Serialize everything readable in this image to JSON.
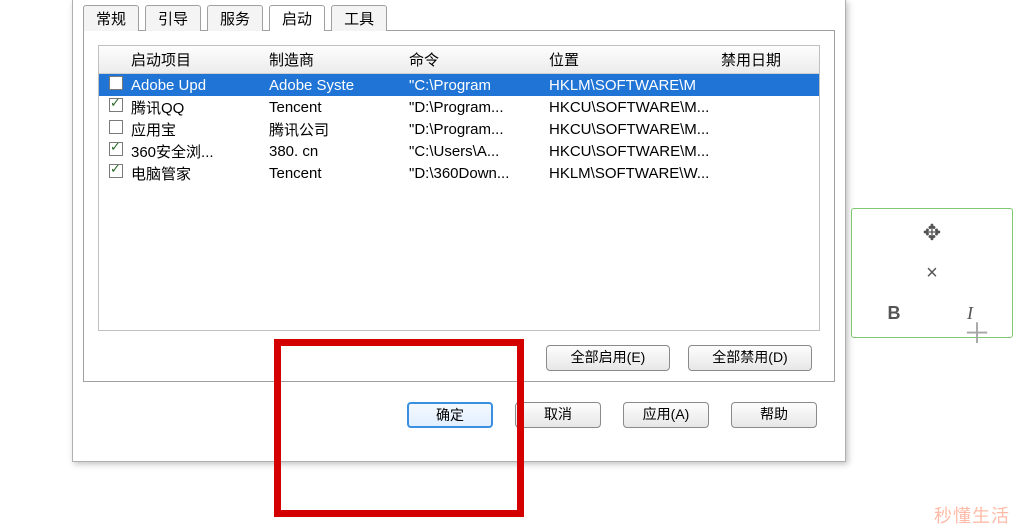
{
  "tabs": {
    "items": [
      {
        "label": "常规",
        "active": false
      },
      {
        "label": "引导",
        "active": false
      },
      {
        "label": "服务",
        "active": false
      },
      {
        "label": "启动",
        "active": true
      },
      {
        "label": "工具",
        "active": false
      }
    ]
  },
  "columns": {
    "c0": "",
    "c1": "启动项目",
    "c2": "制造商",
    "c3": "命令",
    "c4": "位置",
    "c5": "禁用日期"
  },
  "rows": [
    {
      "checked": true,
      "selected": true,
      "item": "Adobe Upd",
      "mfr": "Adobe Syste",
      "cmd": "\"C:\\Program",
      "loc": "HKLM\\SOFTWARE\\M"
    },
    {
      "checked": true,
      "selected": false,
      "item": "腾讯QQ",
      "mfr": "Tencent",
      "cmd": "\"D:\\Program...",
      "loc": "HKCU\\SOFTWARE\\M..."
    },
    {
      "checked": false,
      "selected": false,
      "item": "应用宝",
      "mfr": "腾讯公司",
      "cmd": "\"D:\\Program...",
      "loc": "HKCU\\SOFTWARE\\M..."
    },
    {
      "checked": true,
      "selected": false,
      "item": "360安全浏...",
      "mfr": "380. cn",
      "cmd": "\"C:\\Users\\A...",
      "loc": "HKCU\\SOFTWARE\\M..."
    },
    {
      "checked": true,
      "selected": false,
      "item": "电脑管家",
      "mfr": "Tencent",
      "cmd": "\"D:\\360Down...",
      "loc": "HKLM\\SOFTWARE\\W..."
    }
  ],
  "buttons": {
    "enable_all": "全部启用(E)",
    "disable_all": "全部禁用(D)",
    "ok": "确定",
    "cancel": "取消",
    "apply": "应用(A)",
    "help": "帮助"
  },
  "palette": {
    "bold": "B",
    "italic": "I"
  },
  "watermark": "秒懂生活"
}
